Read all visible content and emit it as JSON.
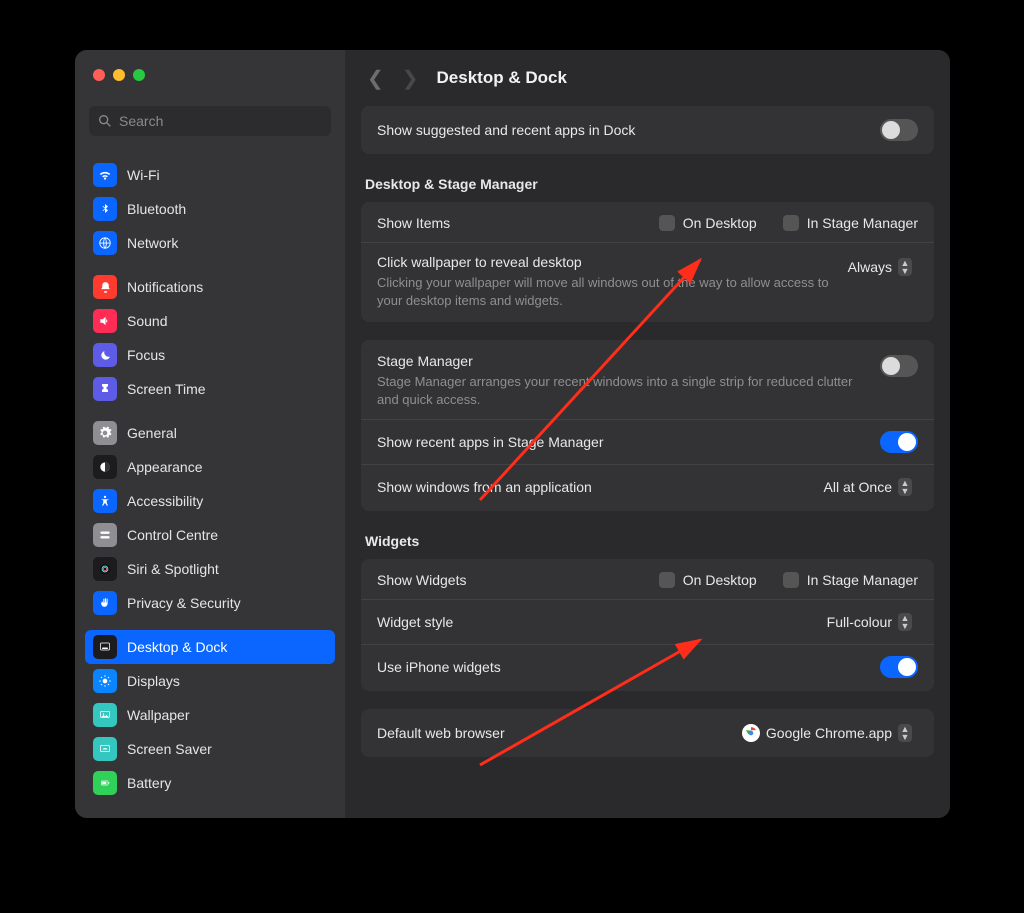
{
  "header": {
    "title": "Desktop & Dock",
    "search_placeholder": "Search"
  },
  "sidebar": {
    "groups": [
      [
        {
          "label": "Wi-Fi",
          "bg": "#0a66ff",
          "icon": "wifi"
        },
        {
          "label": "Bluetooth",
          "bg": "#0a66ff",
          "icon": "bt"
        },
        {
          "label": "Network",
          "bg": "#0a66ff",
          "icon": "globe"
        }
      ],
      [
        {
          "label": "Notifications",
          "bg": "#ff3b30",
          "icon": "bell"
        },
        {
          "label": "Sound",
          "bg": "#ff2d55",
          "icon": "sound"
        },
        {
          "label": "Focus",
          "bg": "#5e5ce6",
          "icon": "moon"
        },
        {
          "label": "Screen Time",
          "bg": "#5e5ce6",
          "icon": "hourglass"
        }
      ],
      [
        {
          "label": "General",
          "bg": "#8e8e93",
          "icon": "gear"
        },
        {
          "label": "Appearance",
          "bg": "#1c1c1e",
          "icon": "appearance"
        },
        {
          "label": "Accessibility",
          "bg": "#0a66ff",
          "icon": "access"
        },
        {
          "label": "Control Centre",
          "bg": "#8e8e93",
          "icon": "control"
        },
        {
          "label": "Siri & Spotlight",
          "bg": "#1c1c1e",
          "icon": "siri"
        },
        {
          "label": "Privacy & Security",
          "bg": "#0a66ff",
          "icon": "hand"
        }
      ],
      [
        {
          "label": "Desktop & Dock",
          "bg": "#1c1c1e",
          "icon": "dock",
          "selected": true
        },
        {
          "label": "Displays",
          "bg": "#0a84ff",
          "icon": "display"
        },
        {
          "label": "Wallpaper",
          "bg": "#34c7c0",
          "icon": "wallpaper"
        },
        {
          "label": "Screen Saver",
          "bg": "#34c7c0",
          "icon": "screensaver"
        },
        {
          "label": "Battery",
          "bg": "#30d158",
          "icon": "battery"
        }
      ]
    ]
  },
  "sections": {
    "top": {
      "suggested_label": "Show suggested and recent apps in Dock",
      "suggested_on": false
    },
    "desktop_stage": {
      "title": "Desktop & Stage Manager",
      "show_items_label": "Show Items",
      "on_desktop": "On Desktop",
      "in_stage_mgr": "In Stage Manager",
      "click_wallpaper_label": "Click wallpaper to reveal desktop",
      "click_wallpaper_sub": "Clicking your wallpaper will move all windows out of the way to allow access to your desktop items and widgets.",
      "click_wallpaper_value": "Always",
      "stage_manager_label": "Stage Manager",
      "stage_manager_sub": "Stage Manager arranges your recent windows into a single strip for reduced clutter and quick access.",
      "stage_manager_on": false,
      "recent_apps_label": "Show recent apps in Stage Manager",
      "recent_apps_on": true,
      "show_windows_label": "Show windows from an application",
      "show_windows_value": "All at Once"
    },
    "widgets": {
      "title": "Widgets",
      "show_widgets_label": "Show Widgets",
      "on_desktop": "On Desktop",
      "in_stage_mgr": "In Stage Manager",
      "widget_style_label": "Widget style",
      "widget_style_value": "Full-colour",
      "iphone_widgets_label": "Use iPhone widgets",
      "iphone_widgets_on": true
    },
    "browser": {
      "label": "Default web browser",
      "value": "Google Chrome.app"
    }
  }
}
